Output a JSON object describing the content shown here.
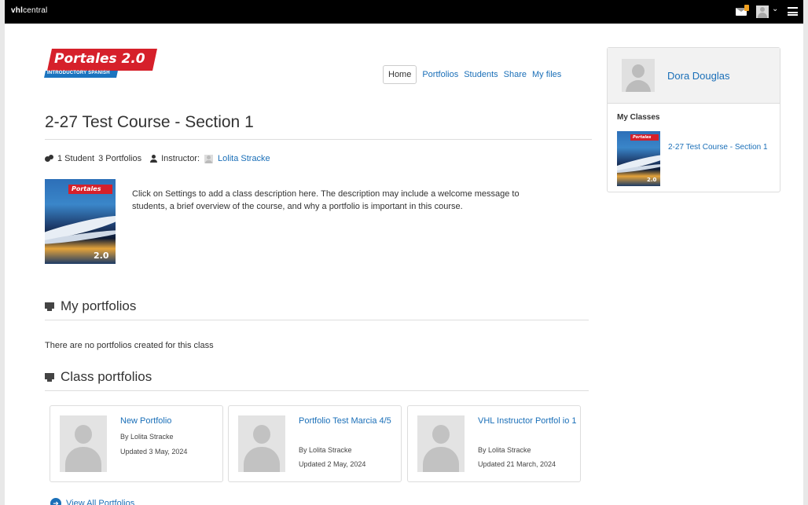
{
  "topbar": {
    "brand_bold": "vhl",
    "brand_rest": "central"
  },
  "logo": {
    "title": "Portales 2.0",
    "subtitle": "INTRODUCTORY SPANISH"
  },
  "nav": {
    "home": "Home",
    "portfolios": "Portfolios",
    "students": "Students",
    "share": "Share",
    "my_files": "My files"
  },
  "course": {
    "title": "2-27 Test Course - Section 1",
    "students": "1 Student",
    "portfolios_count": "3 Portfolios",
    "instructor_label": "Instructor:",
    "instructor_name": "Lolita Stracke",
    "description": "Click on Settings to add a class description here. The description may include a welcome message to students, a brief overview of the course, and why a portfolio is important in this course.",
    "cover_tag": "Portales",
    "cover_version": "2.0"
  },
  "my_portfolios": {
    "heading": "My portfolios",
    "empty": "There are no portfolios created for this class"
  },
  "class_portfolios": {
    "heading": "Class portfolios",
    "cards": [
      {
        "title": "New Portfolio",
        "by": "By Lolita Stracke",
        "updated": "Updated 3 May, 2024"
      },
      {
        "title": "Portfolio Test Marcia 4/5",
        "by": "By Lolita Stracke",
        "updated": "Updated 2 May, 2024"
      },
      {
        "title": "VHL Instructor Portfol io 1",
        "by": "By Lolita Stracke",
        "updated": "Updated 21 March, 2024"
      }
    ],
    "view_all": "View All Portfolios"
  },
  "sidebar": {
    "user_name": "Dora Douglas",
    "my_classes_label": "My Classes",
    "class_name": "2-27 Test Course - Section 1",
    "cover_tag": "Portales",
    "cover_version": "2.0"
  },
  "icons": {
    "mail": "envelope-icon",
    "menu": "hamburger-icon",
    "group": "users-icon",
    "person": "user-icon",
    "section": "presentation-icon",
    "view_all": "circle-arrow-icon"
  },
  "colors": {
    "link": "#1a6fb8",
    "brand_red": "#d6202a",
    "brand_blue": "#1b74bf",
    "topbar": "#000000"
  }
}
